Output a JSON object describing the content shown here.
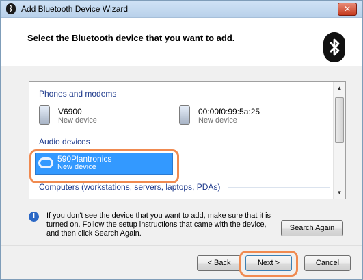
{
  "window": {
    "title": "Add Bluetooth Device Wizard",
    "close_glyph": "✕"
  },
  "header": {
    "heading": "Select the Bluetooth device that you want to add.",
    "logo_icon": "bluetooth-logo-icon"
  },
  "groups": {
    "phones": "Phones and modems",
    "audio": "Audio devices",
    "computers": "Computers (workstations, servers, laptops, PDAs)"
  },
  "devices": {
    "phone1": {
      "name": "V6900",
      "status": "New device",
      "icon": "phone-icon"
    },
    "phone2": {
      "name": "00:00f0:99:5a:25",
      "status": "New device",
      "icon": "phone-icon"
    },
    "audio1": {
      "name": "590Plantronics",
      "status": "New device",
      "icon": "headset-icon",
      "selected": true
    }
  },
  "info": {
    "icon": "info-icon",
    "text": "If you don't see the device that you want to add, make sure that it is turned on. Follow the setup instructions that came with the device, and then click Search Again."
  },
  "buttons": {
    "search_again": "Search Again",
    "back": "< Back",
    "next": "Next >",
    "cancel": "Cancel"
  },
  "colors": {
    "selection": "#3399ff",
    "highlight": "#f08a50",
    "group_header": "#1e3a8c"
  }
}
